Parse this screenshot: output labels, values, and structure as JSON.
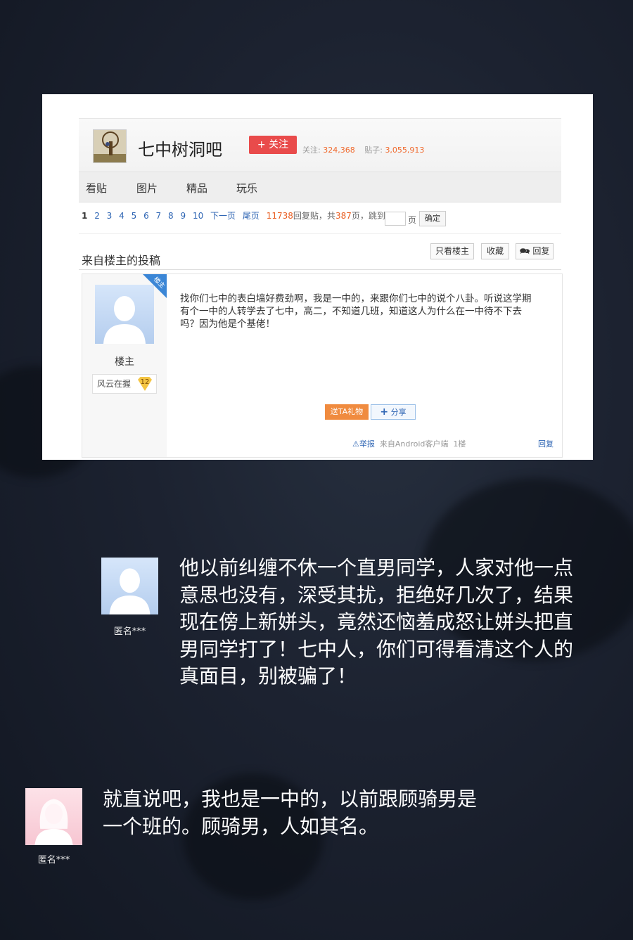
{
  "forum": {
    "title": "七中树洞吧",
    "follow_label": "+ 关注",
    "followers_label": "关注:",
    "followers_count": "324,368",
    "posts_label": "贴子:",
    "posts_count": "3,055,913",
    "tabs": [
      "看贴",
      "图片",
      "精品",
      "玩乐"
    ]
  },
  "pagination": {
    "current": "1",
    "pages": [
      "2",
      "3",
      "4",
      "5",
      "6",
      "7",
      "8",
      "9",
      "10"
    ],
    "next_label": "下一页",
    "last_label": "尾页",
    "replies_count": "11738",
    "replies_label": "回复贴，共",
    "total_pages": "387",
    "pages_suffix": "页，跳到",
    "page_unit": "页",
    "confirm_label": "确定"
  },
  "section": {
    "title": "来自楼主的投稿",
    "only_op_label": "只看楼主",
    "favorite_label": "收藏",
    "reply_label": "回复"
  },
  "post": {
    "corner_label": "楼主",
    "username": "楼主",
    "badge_label": "风云在握",
    "badge_level": "12",
    "body": "找你们七中的表白墙好费劲啊，我是一中的，来跟你们七中的说个八卦。听说这学期有个一中的人转学去了七中，高二，不知道几班，知道这人为什么在一中待不下去吗？因为他是个基佬！",
    "gift_label": "送TA礼物",
    "share_label": "分享",
    "report_label": "举报",
    "source_label": "来自Android客户端",
    "floor_label": "1楼",
    "reply_link_label": "回复"
  },
  "comments": [
    {
      "name": "匿名***",
      "text": "他以前纠缠不休一个直男同学，人家对他一点意思也没有，深受其扰，拒绝好几次了，结果现在傍上新姘头，竟然还恼羞成怒让姘头把直男同学打了！七中人，你们可得看清这个人的真面目，别被骗了！"
    },
    {
      "name": "匿名***",
      "text": "就直说吧，我也是一中的，以前跟顾骑男是一个班的。顾骑男，人如其名。"
    }
  ],
  "colors": {
    "background": "#1c2230",
    "follow_button": "#e94b4b",
    "stat_number": "#f06a2e",
    "link_blue": "#2d64b3",
    "gift_button": "#f08b3f",
    "op_corner": "#3b86d6"
  },
  "icons": [
    "forum-avatar-tree",
    "male-avatar-icon",
    "female-avatar-icon",
    "level-badge-icon",
    "share-plus-icon",
    "reply-bubble-icon",
    "report-warning-icon"
  ]
}
